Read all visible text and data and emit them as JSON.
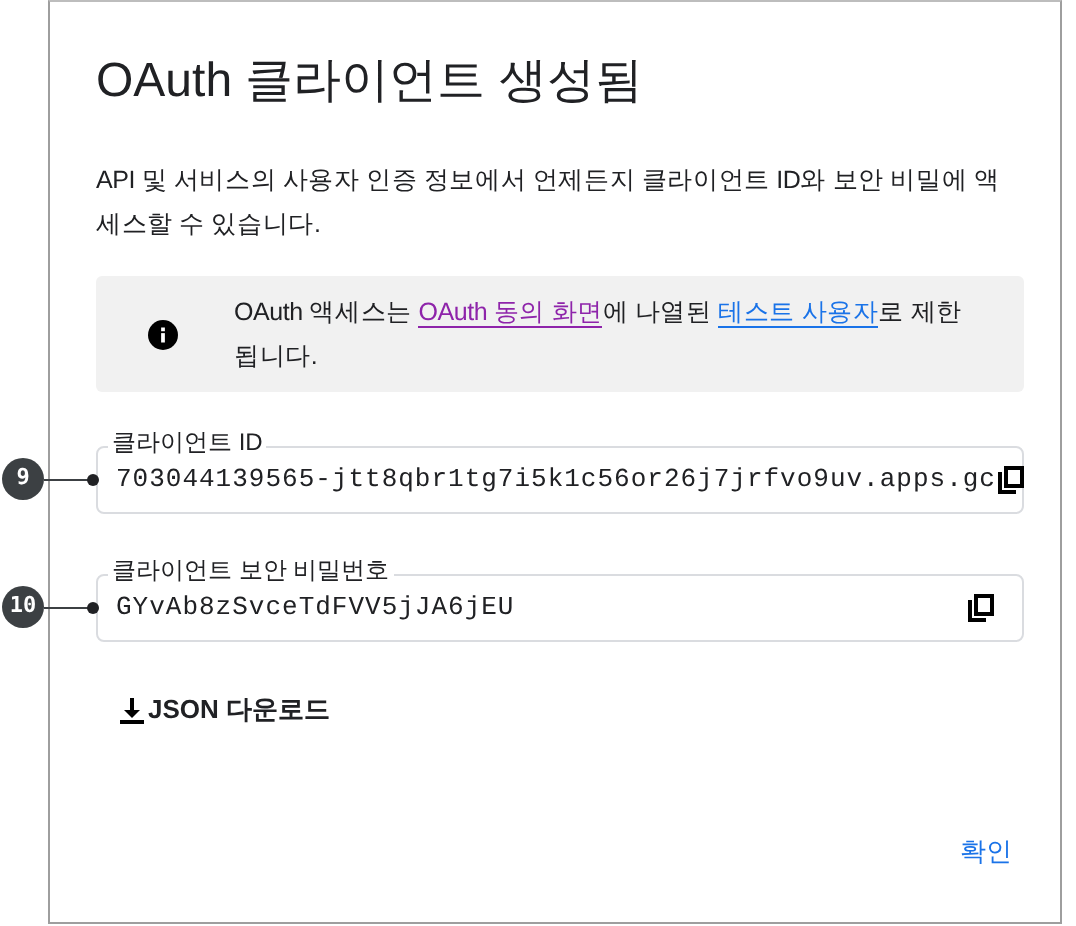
{
  "dialog": {
    "title": "OAuth 클라이언트 생성됨",
    "description": "API 및 서비스의 사용자 인증 정보에서 언제든지 클라이언트 ID와 보안 비밀에 액세스할 수 있습니다.",
    "notice": [
      {
        "kind": "text",
        "text": "OAuth 액세스는 "
      },
      {
        "kind": "link",
        "text": "OAuth 동의 화면",
        "visited": true
      },
      {
        "kind": "text",
        "text": "에 나열된 "
      },
      {
        "kind": "link",
        "text": "테스트 사용자",
        "visited": false
      },
      {
        "kind": "text",
        "text": "로 제한됩니다."
      }
    ],
    "fields": [
      {
        "label": "클라이언트 ID",
        "value": "703044139565-jtt8qbr1tg7i5k1c56or26j7jrfvo9uv.apps.gc",
        "callout": "9"
      },
      {
        "label": "클라이언트 보안 비밀번호",
        "value": "GYvAb8zSvceTdFVV5jJA6jEU",
        "callout": "10"
      }
    ],
    "download_button": "JSON 다운로드",
    "ok_button": "확인"
  }
}
